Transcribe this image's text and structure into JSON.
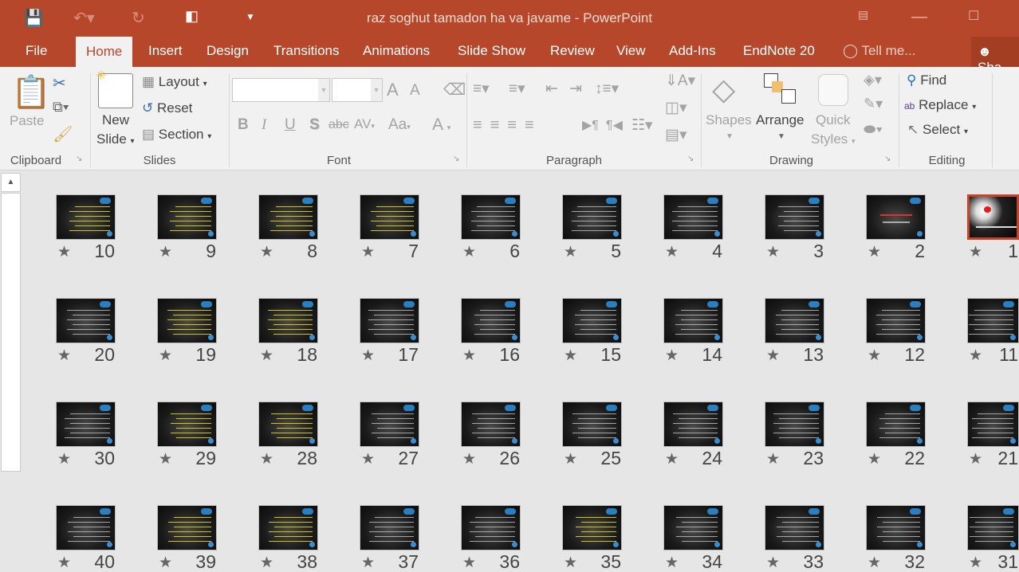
{
  "app": {
    "title": "raz soghut tamadon ha va javame - PowerPoint",
    "accent": "#b7472a"
  },
  "quick_access": {
    "save": "save-icon",
    "undo": "undo-icon",
    "redo": "redo-icon",
    "present": "start-presentation-icon",
    "customize": "customize-toolbar-icon"
  },
  "tabs": [
    "File",
    "Home",
    "Insert",
    "Design",
    "Transitions",
    "Animations",
    "Slide Show",
    "Review",
    "View",
    "Add-Ins",
    "EndNote 20"
  ],
  "active_tab": "Home",
  "tell_me": "Tell me...",
  "share": "Sha",
  "ribbon": {
    "clipboard": {
      "label": "Clipboard",
      "paste": "Paste"
    },
    "slides": {
      "label": "Slides",
      "new_slide_1": "New",
      "new_slide_2": "Slide",
      "layout": "Layout",
      "reset": "Reset",
      "section": "Section"
    },
    "font": {
      "label": "Font",
      "font_name": "",
      "font_size": "",
      "bold": "B",
      "italic": "I",
      "underline": "U",
      "shadow": "S",
      "strike": "abc",
      "spacing": "AV",
      "case": "Aa",
      "color": "A",
      "grow": "A",
      "shrink": "A"
    },
    "paragraph": {
      "label": "Paragraph"
    },
    "drawing": {
      "label": "Drawing",
      "shapes": "Shapes",
      "arrange": "Arrange",
      "quick_1": "Quick",
      "quick_2": "Styles"
    },
    "editing": {
      "label": "Editing",
      "find": "Find",
      "replace": "Replace",
      "select": "Select"
    }
  },
  "slides": [
    {
      "n": "10",
      "style": "yellow"
    },
    {
      "n": "9",
      "style": "yellow"
    },
    {
      "n": "8",
      "style": "yellow"
    },
    {
      "n": "7",
      "style": "yellow"
    },
    {
      "n": "6",
      "style": "white"
    },
    {
      "n": "5",
      "style": "white"
    },
    {
      "n": "4",
      "style": "white"
    },
    {
      "n": "3",
      "style": "white"
    },
    {
      "n": "2",
      "style": "title"
    },
    {
      "n": "1",
      "style": "cover",
      "selected": true
    },
    {
      "n": "20",
      "style": "white"
    },
    {
      "n": "19",
      "style": "yellow"
    },
    {
      "n": "18",
      "style": "yellow"
    },
    {
      "n": "17",
      "style": "white"
    },
    {
      "n": "16",
      "style": "white"
    },
    {
      "n": "15",
      "style": "white"
    },
    {
      "n": "14",
      "style": "white"
    },
    {
      "n": "13",
      "style": "white"
    },
    {
      "n": "12",
      "style": "white"
    },
    {
      "n": "11",
      "style": "white"
    },
    {
      "n": "30",
      "style": "white"
    },
    {
      "n": "29",
      "style": "yellow"
    },
    {
      "n": "28",
      "style": "yellow"
    },
    {
      "n": "27",
      "style": "white"
    },
    {
      "n": "26",
      "style": "white"
    },
    {
      "n": "25",
      "style": "white"
    },
    {
      "n": "24",
      "style": "white"
    },
    {
      "n": "23",
      "style": "white"
    },
    {
      "n": "22",
      "style": "white"
    },
    {
      "n": "21",
      "style": "white"
    },
    {
      "n": "40",
      "style": "white"
    },
    {
      "n": "39",
      "style": "yellow"
    },
    {
      "n": "38",
      "style": "yellow"
    },
    {
      "n": "37",
      "style": "white"
    },
    {
      "n": "36",
      "style": "white"
    },
    {
      "n": "35",
      "style": "yellow"
    },
    {
      "n": "34",
      "style": "white"
    },
    {
      "n": "33",
      "style": "white"
    },
    {
      "n": "32",
      "style": "white"
    },
    {
      "n": "31",
      "style": "white"
    }
  ]
}
